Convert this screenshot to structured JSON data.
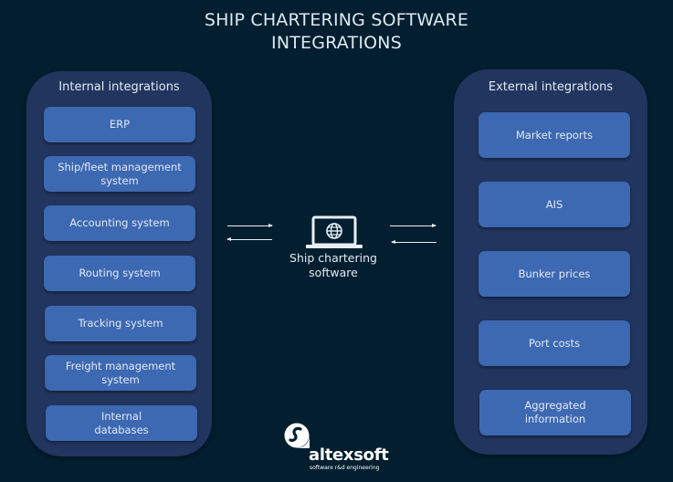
{
  "title": {
    "line1": "SHIP CHARTERING SOFTWARE",
    "line2": "INTEGRATIONS"
  },
  "internal": {
    "title": "Internal integrations",
    "items": [
      {
        "label": "ERP"
      },
      {
        "label": "Ship/fleet management system"
      },
      {
        "label": "Accounting system"
      },
      {
        "label": "Routing system"
      },
      {
        "label": "Tracking system"
      },
      {
        "label": "Freight management system"
      },
      {
        "label": "Internal databases"
      }
    ]
  },
  "center": {
    "icon": "laptop-globe-icon",
    "label_line1": "Ship chartering",
    "label_line2": "software"
  },
  "external": {
    "title": "External integrations",
    "items": [
      {
        "label": "Market reports"
      },
      {
        "label": "AIS"
      },
      {
        "label": "Bunker prices"
      },
      {
        "label": "Port costs"
      },
      {
        "label": "Aggregated information"
      }
    ]
  },
  "logo": {
    "name": "altexsoft",
    "tagline": "software r&d engineering"
  },
  "colors": {
    "background": "#021e2f",
    "panel": "#22355f",
    "item": "#3d68b2",
    "text": "#e3eaf3"
  }
}
